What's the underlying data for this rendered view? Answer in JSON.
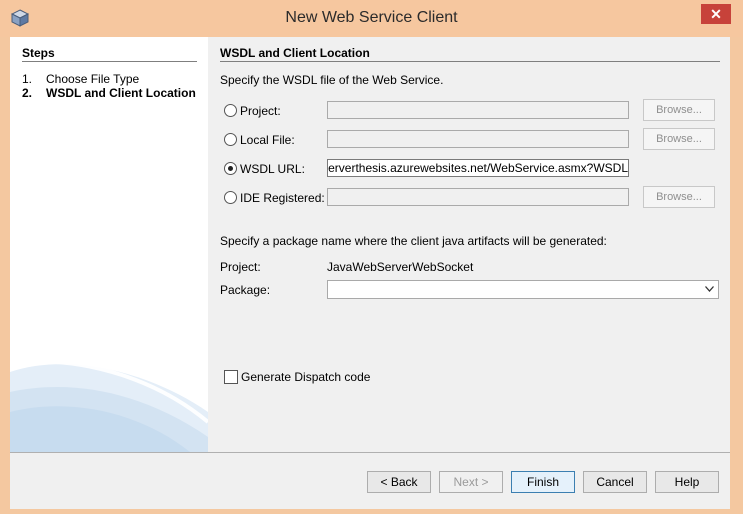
{
  "window": {
    "title": "New Web Service Client",
    "close_glyph": "✕"
  },
  "steps": {
    "heading": "Steps",
    "items": [
      {
        "num": "1.",
        "label": "Choose File Type",
        "active": false
      },
      {
        "num": "2.",
        "label": "WSDL and Client Location",
        "active": true
      }
    ]
  },
  "main": {
    "heading": "WSDL and Client Location",
    "specify_wsdl": "Specify the WSDL file of the Web Service.",
    "sources": [
      {
        "label": "Project:",
        "value": "",
        "selected": false,
        "browse": "Browse..."
      },
      {
        "label": "Local File:",
        "value": "",
        "selected": false,
        "browse": "Browse..."
      },
      {
        "label": "WSDL URL:",
        "value": "http://csharpserverthesis.azurewebsites.net/WebService.asmx?WSDL",
        "selected": true
      },
      {
        "label": "IDE Registered:",
        "value": "",
        "selected": false,
        "browse": "Browse..."
      }
    ],
    "specify_package": "Specify a package name where the client java artifacts will be generated:",
    "project_label": "Project:",
    "project_value": "JavaWebServerWebSocket",
    "package_label": "Package:",
    "package_value": "",
    "dispatch_label": "Generate Dispatch code",
    "dispatch_checked": false
  },
  "buttons": {
    "back": "< Back",
    "next": "Next >",
    "finish": "Finish",
    "cancel": "Cancel",
    "help": "Help"
  }
}
